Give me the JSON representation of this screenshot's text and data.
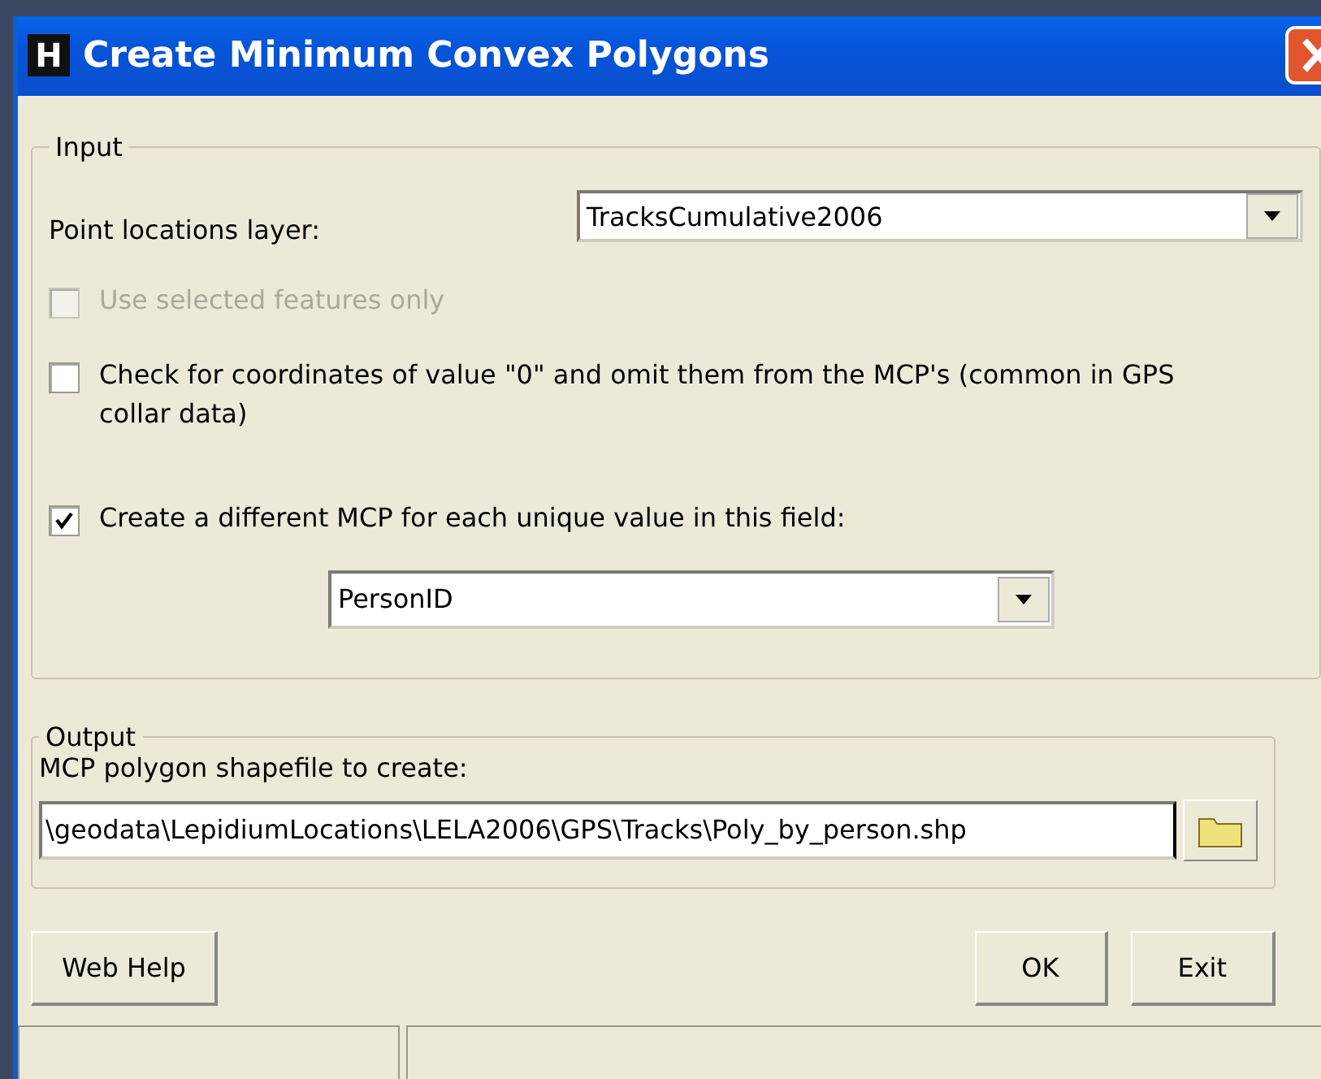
{
  "window": {
    "app_icon": "H",
    "title": "Create Minimum Convex Polygons"
  },
  "input_group": {
    "title": "Input",
    "layer": {
      "label": "Point locations layer:",
      "value": "TracksCumulative2006"
    },
    "options": [
      {
        "kind": "checkbox",
        "label": "Use selected features only",
        "checked": false,
        "disabled": true
      },
      {
        "kind": "checkbox",
        "label": "Check for coordinates of value \"0\" and omit them from the MCP's (common in GPS collar data)",
        "checked": false,
        "disabled": false
      },
      {
        "kind": "checkbox",
        "label": "Create a different MCP for each unique value in this field:",
        "checked": true,
        "disabled": false
      }
    ],
    "field": {
      "value": "PersonID"
    }
  },
  "output_group": {
    "title": "Output",
    "label": "MCP polygon shapefile to create:",
    "path": "\\geodata\\LepidiumLocations\\LELA2006\\GPS\\Tracks\\Poly_by_person.shp"
  },
  "left_buttons": [
    "Web Help"
  ],
  "right_buttons": [
    "OK",
    "Exit"
  ]
}
